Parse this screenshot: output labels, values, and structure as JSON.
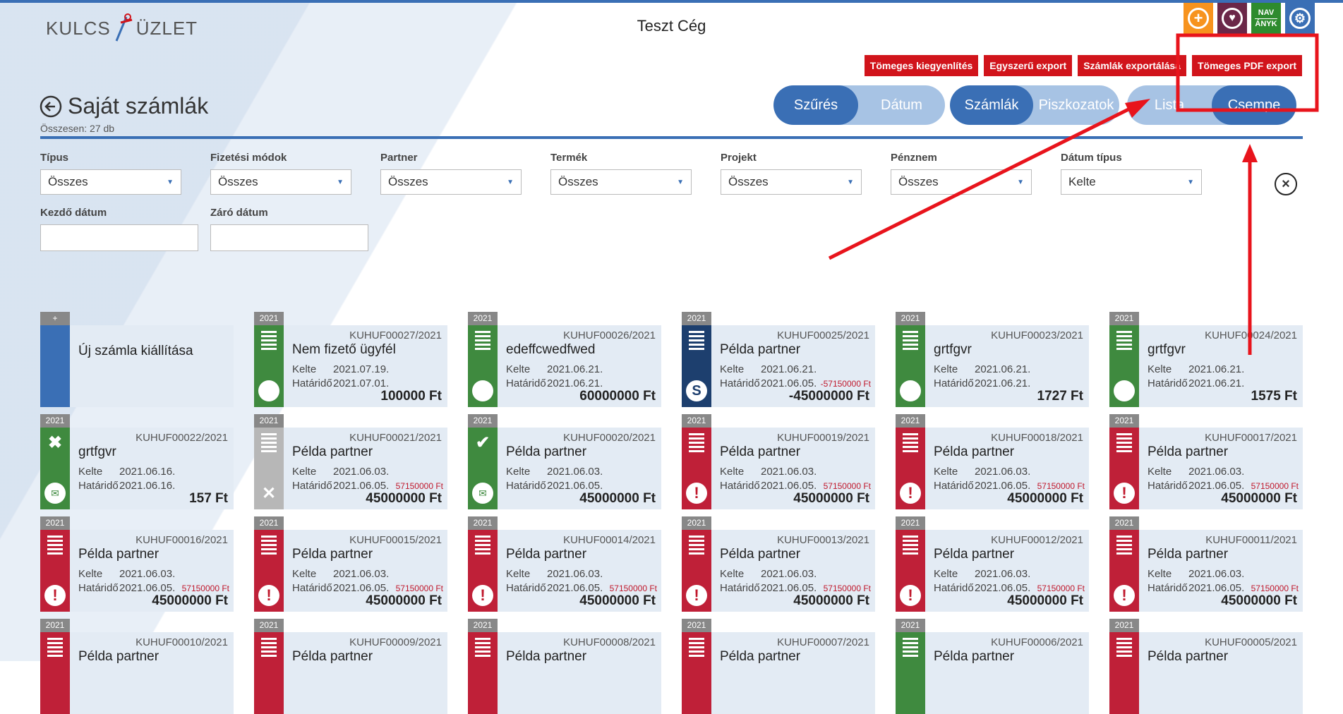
{
  "header": {
    "logo_text_left": "KULCS",
    "logo_text_right": "ÜZLET",
    "company": "Teszt Cég",
    "icons": [
      {
        "name": "add-icon",
        "color": "#f7931e"
      },
      {
        "name": "heart-icon",
        "color": "#6b2748"
      },
      {
        "name": "nav-anyk-icon",
        "color": "#2e8b2e",
        "line1": "NAV",
        "line2": "ÁNYK"
      },
      {
        "name": "gear-icon",
        "color": "#3a6fb5"
      }
    ]
  },
  "actions": {
    "bulk_settle": "Tömeges kiegyenlítés",
    "simple_export": "Egyszerű export",
    "invoice_export": "Számlák exportálása",
    "bulk_pdf": "Tömeges PDF export"
  },
  "page": {
    "title": "Saját számlák",
    "count": "Összesen: 27 db"
  },
  "toggles": {
    "filter": {
      "on": "Szűrés",
      "off": "Dátum"
    },
    "type": {
      "on": "Számlák",
      "off": "Piszkozatok"
    },
    "view": {
      "off": "Lista",
      "on": "Csempe"
    }
  },
  "filters": {
    "type": {
      "label": "Típus",
      "value": "Összes"
    },
    "payment": {
      "label": "Fizetési módok",
      "value": "Összes"
    },
    "partner": {
      "label": "Partner",
      "value": "Összes"
    },
    "product": {
      "label": "Termék",
      "value": "Összes"
    },
    "project": {
      "label": "Projekt",
      "value": "Összes"
    },
    "currency": {
      "label": "Pénznem",
      "value": "Összes"
    },
    "date_type": {
      "label": "Dátum típus",
      "value": "Kelte"
    },
    "start_date": {
      "label": "Kezdő dátum",
      "value": ""
    },
    "end_date": {
      "label": "Záró dátum",
      "value": ""
    }
  },
  "labels": {
    "issued": "Kelte",
    "due": "Határidő",
    "new_year": "+"
  },
  "new_invoice": "Új számla kiállítása",
  "colors": {
    "green": "#3f8a3f",
    "navy": "#1d3f6e",
    "red": "#bf2038",
    "gray": "#b7b7b7",
    "blue": "#3a6fb5",
    "annotation": "#e8141c"
  },
  "cards": [
    {
      "year": "2021",
      "num": "KUHUF00027/2021",
      "partner": "Nem fizető ügyfél",
      "issued": "2021.07.19.",
      "due": "2021.07.01.",
      "overdue": "",
      "amount": "100000 Ft",
      "color": "green",
      "top": "list",
      "bottom": "dot"
    },
    {
      "year": "2021",
      "num": "KUHUF00026/2021",
      "partner": "edeffcwedfwed",
      "issued": "2021.06.21.",
      "due": "2021.06.21.",
      "overdue": "",
      "amount": "60000000 Ft",
      "color": "green",
      "top": "list",
      "bottom": "dot"
    },
    {
      "year": "2021",
      "num": "KUHUF00025/2021",
      "partner": "Példa partner",
      "issued": "2021.06.21.",
      "due": "2021.06.05.",
      "overdue": "-57150000 Ft",
      "amount": "-45000000 Ft",
      "color": "navy",
      "top": "list",
      "bottom": "s"
    },
    {
      "year": "2021",
      "num": "KUHUF00023/2021",
      "partner": "grtfgvr",
      "issued": "2021.06.21.",
      "due": "2021.06.21.",
      "overdue": "",
      "amount": "1727 Ft",
      "color": "green",
      "top": "list",
      "bottom": "dot"
    },
    {
      "year": "2021",
      "num": "KUHUF00024/2021",
      "partner": "grtfgvr",
      "issued": "2021.06.21.",
      "due": "2021.06.21.",
      "overdue": "",
      "amount": "1575 Ft",
      "color": "green",
      "top": "list",
      "bottom": "dot"
    },
    {
      "year": "2021",
      "num": "KUHUF00022/2021",
      "partner": "grtfgvr",
      "issued": "2021.06.16.",
      "due": "2021.06.16.",
      "overdue": "",
      "amount": "157 Ft",
      "color": "green",
      "top": "x",
      "bottom": "mail"
    },
    {
      "year": "2021",
      "num": "KUHUF00021/2021",
      "partner": "Példa partner",
      "issued": "2021.06.03.",
      "due": "2021.06.05.",
      "overdue": "57150000 Ft",
      "amount": "45000000 Ft",
      "color": "gray",
      "top": "list",
      "bottom": "xmark"
    },
    {
      "year": "2021",
      "num": "KUHUF00020/2021",
      "partner": "Példa partner",
      "issued": "2021.06.03.",
      "due": "2021.06.05.",
      "overdue": "",
      "amount": "45000000 Ft",
      "color": "green",
      "top": "check",
      "bottom": "mail"
    },
    {
      "year": "2021",
      "num": "KUHUF00019/2021",
      "partner": "Példa partner",
      "issued": "2021.06.03.",
      "due": "2021.06.05.",
      "overdue": "57150000 Ft",
      "amount": "45000000 Ft",
      "color": "red",
      "top": "list",
      "bottom": "alert"
    },
    {
      "year": "2021",
      "num": "KUHUF00018/2021",
      "partner": "Példa partner",
      "issued": "2021.06.03.",
      "due": "2021.06.05.",
      "overdue": "57150000 Ft",
      "amount": "45000000 Ft",
      "color": "red",
      "top": "list",
      "bottom": "alert"
    },
    {
      "year": "2021",
      "num": "KUHUF00017/2021",
      "partner": "Példa partner",
      "issued": "2021.06.03.",
      "due": "2021.06.05.",
      "overdue": "57150000 Ft",
      "amount": "45000000 Ft",
      "color": "red",
      "top": "list",
      "bottom": "alert"
    },
    {
      "year": "2021",
      "num": "KUHUF00016/2021",
      "partner": "Példa partner",
      "issued": "2021.06.03.",
      "due": "2021.06.05.",
      "overdue": "57150000 Ft",
      "amount": "45000000 Ft",
      "color": "red",
      "top": "list",
      "bottom": "alert"
    },
    {
      "year": "2021",
      "num": "KUHUF00015/2021",
      "partner": "Példa partner",
      "issued": "2021.06.03.",
      "due": "2021.06.05.",
      "overdue": "57150000 Ft",
      "amount": "45000000 Ft",
      "color": "red",
      "top": "list",
      "bottom": "alert"
    },
    {
      "year": "2021",
      "num": "KUHUF00014/2021",
      "partner": "Példa partner",
      "issued": "2021.06.03.",
      "due": "2021.06.05.",
      "overdue": "57150000 Ft",
      "amount": "45000000 Ft",
      "color": "red",
      "top": "list",
      "bottom": "alert"
    },
    {
      "year": "2021",
      "num": "KUHUF00013/2021",
      "partner": "Példa partner",
      "issued": "2021.06.03.",
      "due": "2021.06.05.",
      "overdue": "57150000 Ft",
      "amount": "45000000 Ft",
      "color": "red",
      "top": "list",
      "bottom": "alert"
    },
    {
      "year": "2021",
      "num": "KUHUF00012/2021",
      "partner": "Példa partner",
      "issued": "2021.06.03.",
      "due": "2021.06.05.",
      "overdue": "57150000 Ft",
      "amount": "45000000 Ft",
      "color": "red",
      "top": "list",
      "bottom": "alert"
    },
    {
      "year": "2021",
      "num": "KUHUF00011/2021",
      "partner": "Példa partner",
      "issued": "2021.06.03.",
      "due": "2021.06.05.",
      "overdue": "57150000 Ft",
      "amount": "45000000 Ft",
      "color": "red",
      "top": "list",
      "bottom": "alert"
    },
    {
      "year": "2021",
      "num": "KUHUF00010/2021",
      "partner": "Példa partner",
      "issued": "",
      "due": "",
      "overdue": "",
      "amount": "",
      "color": "red",
      "top": "list",
      "bottom": ""
    },
    {
      "year": "2021",
      "num": "KUHUF00009/2021",
      "partner": "Példa partner",
      "issued": "",
      "due": "",
      "overdue": "",
      "amount": "",
      "color": "red",
      "top": "list",
      "bottom": ""
    },
    {
      "year": "2021",
      "num": "KUHUF00008/2021",
      "partner": "Példa partner",
      "issued": "",
      "due": "",
      "overdue": "",
      "amount": "",
      "color": "red",
      "top": "list",
      "bottom": ""
    },
    {
      "year": "2021",
      "num": "KUHUF00007/2021",
      "partner": "Példa partner",
      "issued": "",
      "due": "",
      "overdue": "",
      "amount": "",
      "color": "red",
      "top": "list",
      "bottom": ""
    },
    {
      "year": "2021",
      "num": "KUHUF00006/2021",
      "partner": "Példa partner",
      "issued": "",
      "due": "",
      "overdue": "",
      "amount": "",
      "color": "green",
      "top": "list",
      "bottom": ""
    },
    {
      "year": "2021",
      "num": "KUHUF00005/2021",
      "partner": "Példa partner",
      "issued": "",
      "due": "",
      "overdue": "",
      "amount": "",
      "color": "red",
      "top": "list",
      "bottom": ""
    }
  ]
}
